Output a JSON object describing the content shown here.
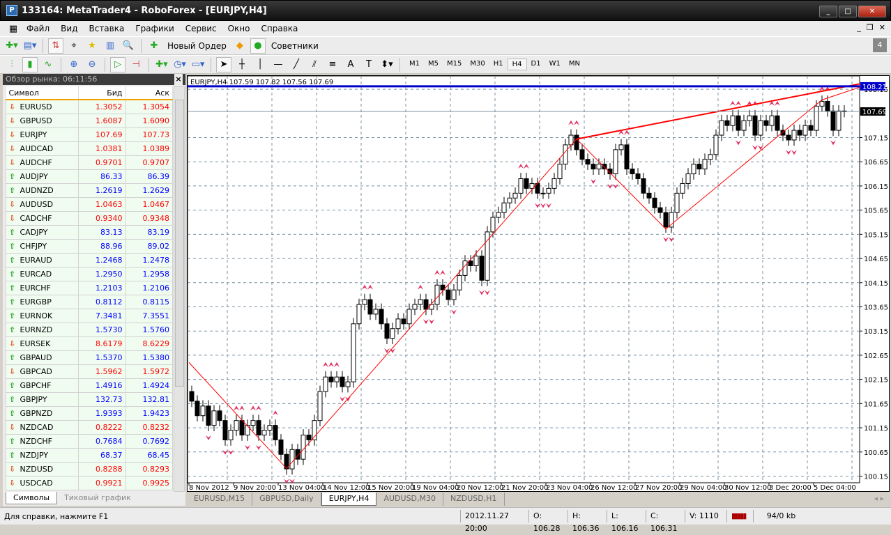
{
  "window": {
    "title": "133164: MetaTrader4 - RoboForex - [EURJPY,H4]",
    "min": "_",
    "max": "□",
    "close": "✕"
  },
  "menu": [
    "Файл",
    "Вид",
    "Вставка",
    "Графики",
    "Сервис",
    "Окно",
    "Справка"
  ],
  "toolbar": {
    "new_order": "Новый Ордер",
    "experts": "Советники",
    "timeframes": [
      "M1",
      "M5",
      "M15",
      "M30",
      "H1",
      "H4",
      "D1",
      "W1",
      "MN"
    ],
    "active_tf": "H4"
  },
  "market_watch": {
    "title": "Обзор рынка: 06:11:56",
    "close": "×",
    "columns": [
      "Символ",
      "Бид",
      "Аск"
    ],
    "rows": [
      [
        "EURUSD",
        "1.3052",
        "1.3054",
        "dn"
      ],
      [
        "GBPUSD",
        "1.6087",
        "1.6090",
        "dn"
      ],
      [
        "EURJPY",
        "107.69",
        "107.73",
        "dn"
      ],
      [
        "AUDCAD",
        "1.0381",
        "1.0389",
        "dn"
      ],
      [
        "AUDCHF",
        "0.9701",
        "0.9707",
        "dn"
      ],
      [
        "AUDJPY",
        "86.33",
        "86.39",
        "up"
      ],
      [
        "AUDNZD",
        "1.2619",
        "1.2629",
        "up"
      ],
      [
        "AUDUSD",
        "1.0463",
        "1.0467",
        "dn"
      ],
      [
        "CADCHF",
        "0.9340",
        "0.9348",
        "dn"
      ],
      [
        "CADJPY",
        "83.13",
        "83.19",
        "up"
      ],
      [
        "CHFJPY",
        "88.96",
        "89.02",
        "up"
      ],
      [
        "EURAUD",
        "1.2468",
        "1.2478",
        "up"
      ],
      [
        "EURCAD",
        "1.2950",
        "1.2958",
        "up"
      ],
      [
        "EURCHF",
        "1.2103",
        "1.2106",
        "up"
      ],
      [
        "EURGBP",
        "0.8112",
        "0.8115",
        "up"
      ],
      [
        "EURNOK",
        "7.3481",
        "7.3551",
        "up"
      ],
      [
        "EURNZD",
        "1.5730",
        "1.5760",
        "up"
      ],
      [
        "EURSEK",
        "8.6179",
        "8.6229",
        "dn"
      ],
      [
        "GBPAUD",
        "1.5370",
        "1.5380",
        "up"
      ],
      [
        "GBPCAD",
        "1.5962",
        "1.5972",
        "dn"
      ],
      [
        "GBPCHF",
        "1.4916",
        "1.4924",
        "up"
      ],
      [
        "GBPJPY",
        "132.73",
        "132.81",
        "up"
      ],
      [
        "GBPNZD",
        "1.9393",
        "1.9423",
        "up"
      ],
      [
        "NZDCAD",
        "0.8222",
        "0.8232",
        "dn"
      ],
      [
        "NZDCHF",
        "0.7684",
        "0.7692",
        "up"
      ],
      [
        "NZDJPY",
        "68.37",
        "68.45",
        "up"
      ],
      [
        "NZDUSD",
        "0.8288",
        "0.8293",
        "dn"
      ],
      [
        "USDCAD",
        "0.9921",
        "0.9925",
        "dn"
      ]
    ],
    "tabs": [
      "Символы",
      "Тиковый график"
    ]
  },
  "chart_tabs": [
    "EURUSD,M15",
    "GBPUSD,Daily",
    "EURJPY,H4",
    "AUDUSD,M30",
    "NZDUSD,H1"
  ],
  "active_chart_tab": "EURJPY,H4",
  "status": {
    "help": "Для справки, нажмите F1",
    "time": "2012.11.27 20:00",
    "open": "O: 106.28",
    "high": "H: 106.36",
    "low": "L: 106.16",
    "close": "C: 106.31",
    "volume": "V: 1110",
    "traffic": "94/0 kb"
  },
  "chart_data": {
    "type": "candlestick",
    "title": "EURJPY,H4  107.59 107.82 107.56 107.69",
    "ylim": [
      100.15,
      108.25
    ],
    "yticks": [
      "108.15",
      "107.15",
      "106.65",
      "106.15",
      "105.65",
      "105.15",
      "104.65",
      "104.15",
      "103.65",
      "103.15",
      "102.65",
      "102.15",
      "101.65",
      "101.15",
      "100.65",
      "100.15"
    ],
    "xticks": [
      {
        "bar": 0,
        "label": "8 Nov 2012"
      },
      {
        "bar": 8,
        "label": "9 Nov 20:00"
      },
      {
        "bar": 16,
        "label": "13 Nov 04:00"
      },
      {
        "bar": 24,
        "label": "14 Nov 12:00"
      },
      {
        "bar": 32,
        "label": "15 Nov 20:00"
      },
      {
        "bar": 40,
        "label": "19 Nov 04:00"
      },
      {
        "bar": 48,
        "label": "20 Nov 12:00"
      },
      {
        "bar": 56,
        "label": "21 Nov 20:00"
      },
      {
        "bar": 64,
        "label": "23 Nov 04:00"
      },
      {
        "bar": 72,
        "label": "26 Nov 12:00"
      },
      {
        "bar": 80,
        "label": "27 Nov 20:00"
      },
      {
        "bar": 88,
        "label": "29 Nov 04:00"
      },
      {
        "bar": 96,
        "label": "30 Nov 12:00"
      },
      {
        "bar": 104,
        "label": "3 Dec 20:00"
      },
      {
        "bar": 112,
        "label": "5 Dec 04:00"
      }
    ],
    "open_first": 101.9,
    "closes": [
      101.7,
      101.4,
      101.6,
      101.2,
      101.5,
      101.3,
      100.9,
      101.1,
      101.3,
      101.0,
      101.2,
      101.3,
      101.0,
      101.1,
      101.2,
      100.9,
      100.6,
      100.3,
      100.7,
      100.5,
      101.0,
      100.9,
      101.3,
      101.9,
      102.2,
      102.1,
      102.2,
      102.0,
      102.1,
      103.3,
      103.7,
      103.8,
      103.5,
      103.6,
      103.3,
      103.0,
      103.2,
      103.4,
      103.3,
      103.6,
      103.7,
      103.8,
      103.6,
      103.7,
      104.1,
      104.0,
      103.8,
      104.0,
      104.3,
      104.6,
      104.5,
      104.7,
      104.2,
      105.2,
      105.5,
      105.6,
      105.8,
      105.9,
      106.0,
      106.3,
      106.1,
      106.2,
      106.0,
      106.0,
      106.1,
      106.3,
      106.6,
      107.0,
      107.2,
      106.9,
      106.7,
      106.6,
      106.5,
      106.6,
      106.5,
      106.4,
      106.9,
      107.0,
      106.5,
      106.4,
      106.3,
      106.0,
      105.9,
      105.7,
      105.6,
      105.3,
      105.6,
      106.0,
      106.2,
      106.4,
      106.6,
      106.5,
      106.7,
      106.8,
      107.2,
      107.5,
      107.4,
      107.6,
      107.3,
      107.5,
      107.6,
      107.2,
      107.5,
      107.4,
      107.6,
      107.3,
      107.2,
      107.1,
      107.3,
      107.2,
      107.4,
      107.3,
      107.8,
      107.9,
      107.7,
      107.3,
      107.7,
      107.69
    ],
    "zigzag": [
      [
        -0.5,
        102.5
      ],
      [
        17,
        100.31
      ],
      [
        69,
        107.12
      ],
      [
        85,
        105.26
      ],
      [
        113,
        107.93
      ],
      [
        120,
        108.2
      ]
    ],
    "trendline": [
      [
        69,
        107.12
      ],
      [
        120,
        108.26
      ]
    ],
    "hline": {
      "price": 108.21,
      "label": "108.21",
      "color": "#0000cc"
    },
    "current_price": {
      "price": 107.69,
      "label": "107.69"
    }
  }
}
